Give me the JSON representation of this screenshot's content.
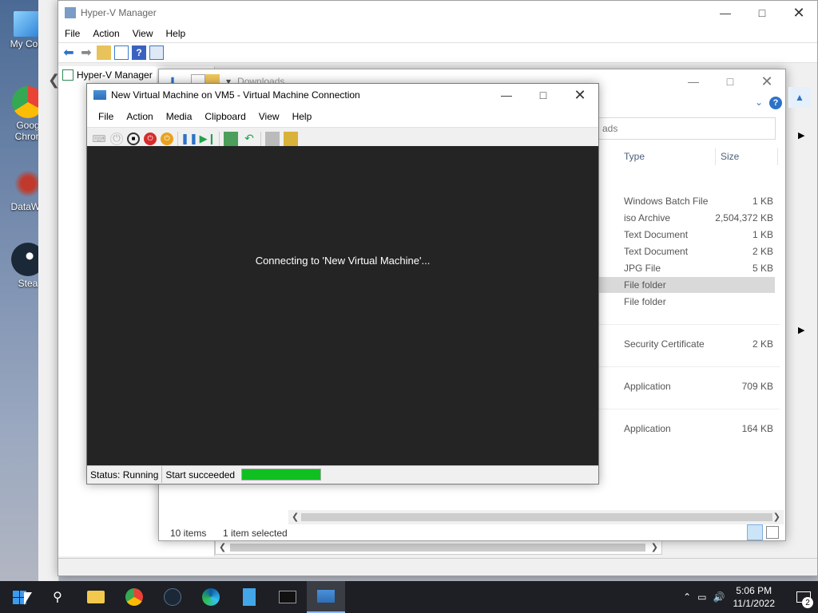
{
  "desktop": {
    "icons": [
      {
        "label": "My Com"
      },
      {
        "label": "Goog"
      },
      {
        "label": "Chron"
      },
      {
        "label": "DataWa"
      },
      {
        "label": "Stea"
      }
    ]
  },
  "hyperv": {
    "title": "Hyper-V Manager",
    "menu": [
      "File",
      "Action",
      "View",
      "Help"
    ],
    "tree_root": "Hyper-V Manager"
  },
  "explorer": {
    "breadcrumb": "Downloads",
    "address_tail": "ads",
    "col_type": "Type",
    "col_size": "Size",
    "rows": [
      {
        "type": "Windows Batch File",
        "size": "1 KB"
      },
      {
        "type": "iso Archive",
        "size": "2,504,372 KB"
      },
      {
        "type": "Text Document",
        "size": "1 KB"
      },
      {
        "type": "Text Document",
        "size": "2 KB"
      },
      {
        "type": "JPG File",
        "size": "5 KB"
      },
      {
        "type": "File folder",
        "size": ""
      },
      {
        "type": "File folder",
        "size": ""
      },
      {
        "type": "Security Certificate",
        "size": "2 KB"
      },
      {
        "type": "Application",
        "size": "709 KB"
      },
      {
        "type": "Application",
        "size": "164 KB"
      }
    ],
    "status_items": "10 items",
    "status_selected": "1 item selected"
  },
  "vm": {
    "title": "New Virtual Machine on VM5 - Virtual Machine Connection",
    "menu": [
      "File",
      "Action",
      "Media",
      "Clipboard",
      "View",
      "Help"
    ],
    "screen_message": "Connecting to 'New Virtual Machine'...",
    "status": "Status: Running",
    "result": "Start succeeded",
    "progress_percent": 100,
    "progress_color": "#10c021"
  },
  "taskbar": {
    "time": "5:06 PM",
    "date": "11/1/2022",
    "notification_count": "2"
  }
}
